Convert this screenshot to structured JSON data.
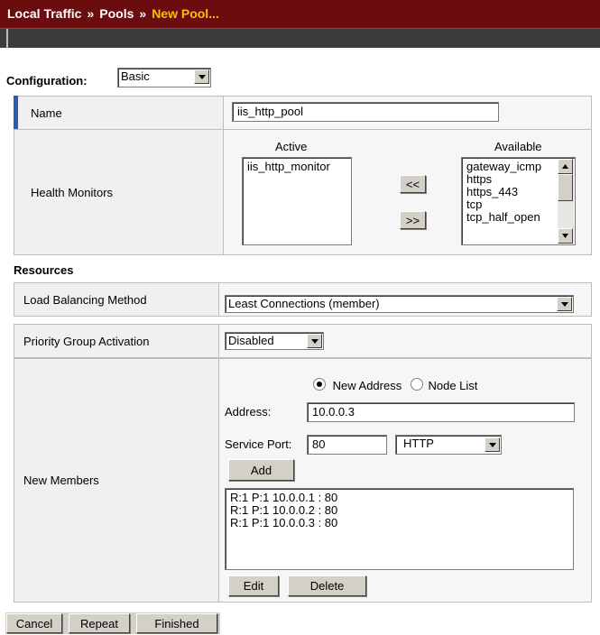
{
  "breadcrumb": {
    "item1": "Local Traffic",
    "item2": "Pools",
    "item3": "New Pool...",
    "separator": "»"
  },
  "configuration": {
    "label": "Configuration:",
    "value": "Basic"
  },
  "name": {
    "label": "Name",
    "value": "iis_http_pool"
  },
  "health_monitors": {
    "label": "Health Monitors",
    "active_header": "Active",
    "available_header": "Available",
    "active": [
      "iis_http_monitor"
    ],
    "available": [
      "gateway_icmp",
      "https",
      "https_443",
      "tcp",
      "tcp_half_open"
    ],
    "move_left": "<<",
    "move_right": ">>"
  },
  "resources": {
    "title": "Resources",
    "lb_method": {
      "label": "Load Balancing Method",
      "value": "Least Connections (member)"
    },
    "priority": {
      "label": "Priority Group Activation",
      "value": "Disabled"
    },
    "members": {
      "label": "New Members",
      "radio_new": "New Address",
      "radio_node": "Node List",
      "address_label": "Address:",
      "address_value": "10.0.0.3",
      "port_label": "Service Port:",
      "port_value": "80",
      "service_value": "HTTP",
      "add": "Add",
      "list": [
        "R:1 P:1 10.0.0.1 : 80",
        "R:1 P:1 10.0.0.2 : 80",
        "R:1 P:1 10.0.0.3 : 80"
      ],
      "edit": "Edit",
      "delete": "Delete"
    }
  },
  "footer": {
    "cancel": "Cancel",
    "repeat": "Repeat",
    "finished": "Finished"
  },
  "colors": {
    "titlebar": "#6b0c0f",
    "current": "#f5c400",
    "accent": "#2a5ea8"
  }
}
